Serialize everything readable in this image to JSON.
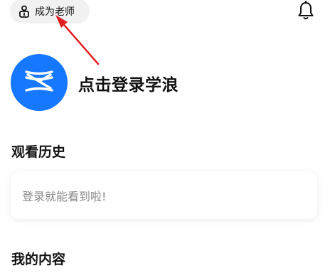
{
  "header": {
    "become_teacher_label": "成为老师",
    "become_teacher_icon": "teacher-person-icon",
    "notification_icon": "bell-icon"
  },
  "profile": {
    "avatar_icon": "xuelang-logo-icon",
    "avatar_color": "#1677ff",
    "login_prompt": "点击登录学浪"
  },
  "history": {
    "title": "观看历史",
    "empty_message": "登录就能看到啦!"
  },
  "my_content": {
    "title": "我的内容"
  },
  "annotation": {
    "arrow_color": "#e02020"
  }
}
